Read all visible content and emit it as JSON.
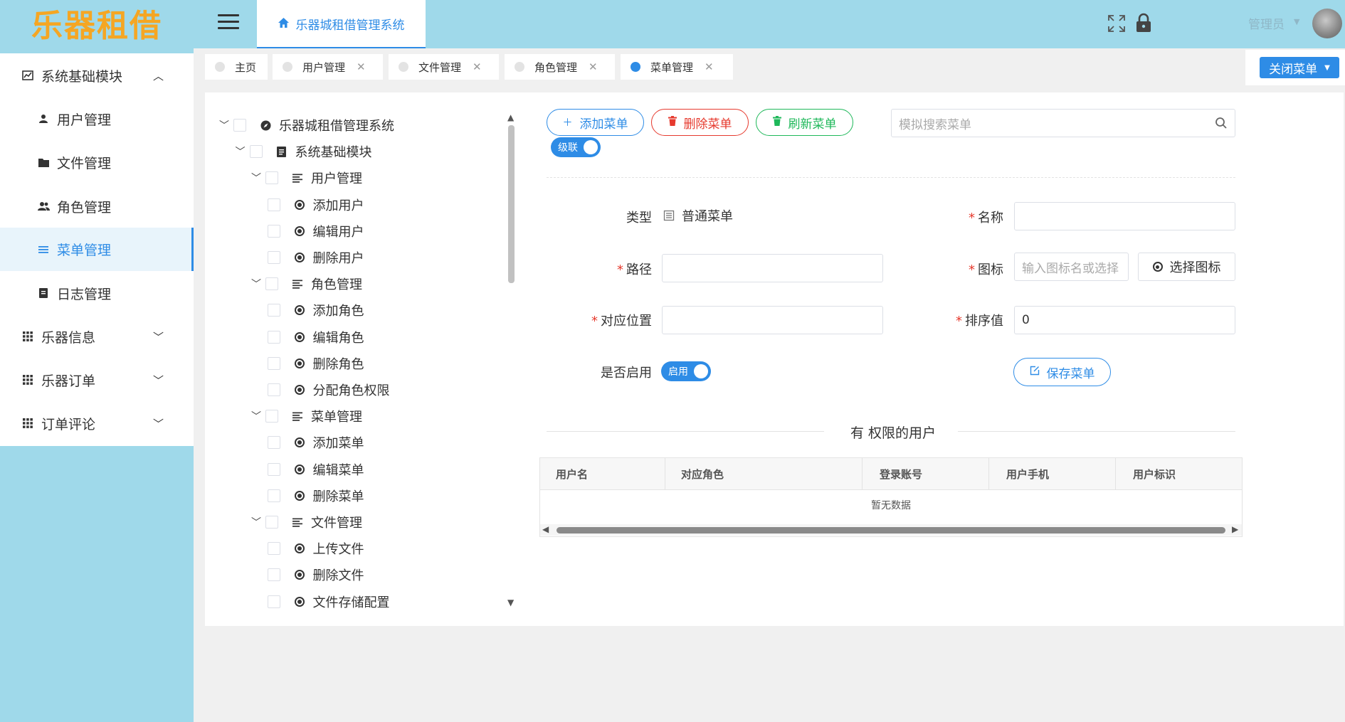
{
  "logo": "乐器租借",
  "header": {
    "home_tab": "乐器城租借管理系统",
    "admin": "管理员"
  },
  "sidebar": {
    "items": [
      {
        "label": "系统基础模块",
        "icon": "chart-icon",
        "expanded": true
      },
      {
        "label": "用户管理",
        "icon": "user-icon"
      },
      {
        "label": "文件管理",
        "icon": "folder-icon"
      },
      {
        "label": "角色管理",
        "icon": "users-icon"
      },
      {
        "label": "菜单管理",
        "icon": "list-icon",
        "active": true
      },
      {
        "label": "日志管理",
        "icon": "doc-icon"
      },
      {
        "label": "乐器信息",
        "icon": "grid-icon",
        "expanded": false
      },
      {
        "label": "乐器订单",
        "icon": "grid-icon",
        "expanded": false
      },
      {
        "label": "订单评论",
        "icon": "grid-icon",
        "expanded": false
      }
    ]
  },
  "tabs": [
    {
      "label": "主页"
    },
    {
      "label": "用户管理"
    },
    {
      "label": "文件管理"
    },
    {
      "label": "角色管理"
    },
    {
      "label": "菜单管理",
      "active": true
    }
  ],
  "close_menu_label": "关闭菜单",
  "tree": [
    {
      "label": "乐器城租借管理系统",
      "level": 0,
      "icon": "compass-icon"
    },
    {
      "label": "系统基础模块",
      "level": 1,
      "icon": "doc-icon"
    },
    {
      "label": "用户管理",
      "level": 2,
      "icon": "lines-icon"
    },
    {
      "label": "添加用户",
      "level": 3,
      "icon": "radio-icon"
    },
    {
      "label": "编辑用户",
      "level": 3,
      "icon": "radio-icon"
    },
    {
      "label": "删除用户",
      "level": 3,
      "icon": "radio-icon"
    },
    {
      "label": "角色管理",
      "level": 2,
      "icon": "lines-icon"
    },
    {
      "label": "添加角色",
      "level": 3,
      "icon": "radio-icon"
    },
    {
      "label": "编辑角色",
      "level": 3,
      "icon": "radio-icon"
    },
    {
      "label": "删除角色",
      "level": 3,
      "icon": "radio-icon"
    },
    {
      "label": "分配角色权限",
      "level": 3,
      "icon": "radio-icon"
    },
    {
      "label": "菜单管理",
      "level": 2,
      "icon": "lines-icon"
    },
    {
      "label": "添加菜单",
      "level": 3,
      "icon": "radio-icon"
    },
    {
      "label": "编辑菜单",
      "level": 3,
      "icon": "radio-icon"
    },
    {
      "label": "删除菜单",
      "level": 3,
      "icon": "radio-icon"
    },
    {
      "label": "文件管理",
      "level": 2,
      "icon": "lines-icon"
    },
    {
      "label": "上传文件",
      "level": 3,
      "icon": "radio-icon"
    },
    {
      "label": "删除文件",
      "level": 3,
      "icon": "radio-icon"
    },
    {
      "label": "文件存储配置",
      "level": 3,
      "icon": "radio-icon"
    }
  ],
  "toolbar": {
    "add": "添加菜单",
    "delete": "删除菜单",
    "refresh": "刷新菜单",
    "search_placeholder": "模拟搜索菜单",
    "cascade": "级联"
  },
  "form": {
    "type_label": "类型",
    "type_value": "普通菜单",
    "name_label": "名称",
    "path_label": "路径",
    "icon_label": "图标",
    "icon_placeholder": "输入图标名或选择",
    "choose_icon": "选择图标",
    "position_label": "对应位置",
    "sort_label": "排序值",
    "sort_value": "0",
    "enabled_label": "是否启用",
    "enabled_value": "启用",
    "save": "保存菜单"
  },
  "users_section": {
    "title": "有 权限的用户",
    "columns": [
      "用户名",
      "对应角色",
      "登录账号",
      "用户手机",
      "用户标识"
    ],
    "empty_text": "暂无数据"
  },
  "colors": {
    "primary": "#2e8ce6",
    "danger": "#e63a2e",
    "success": "#1fb85a",
    "header_bg": "#9fd9ea",
    "logo": "#f5a623"
  }
}
